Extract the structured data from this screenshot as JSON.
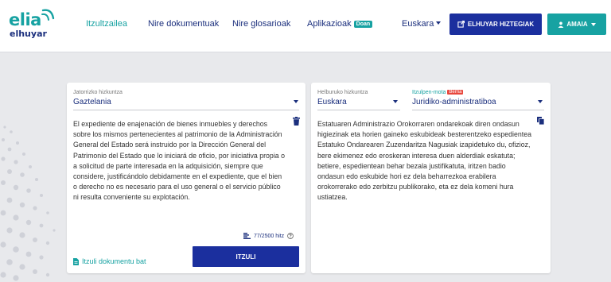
{
  "header": {
    "logo": {
      "brand": "elia",
      "sub": "elhuyar"
    },
    "nav": [
      {
        "label": "Itzultzailea",
        "active": true
      },
      {
        "label": "Nire dokumentuak"
      },
      {
        "label": "Nire glosarioak"
      },
      {
        "label": "Aplikazioak",
        "badge": "Doan"
      }
    ],
    "language": "Euskara",
    "dictionaries_button": "ELHUYAR HIZTEGIAK",
    "user_button": "AMAIA"
  },
  "source": {
    "language_label": "Jatorrizko hizkuntza",
    "language_value": "Gaztelania",
    "text": "El expediente de enajenación de bienes inmuebles y derechos sobre los mismos pertenecientes al patrimonio de la Administración General del Estado será instruido por la Dirección General del Patrimonio del Estado que lo iniciará de oficio, por iniciativa propia o a solicitud de parte interesada en la adquisición, siempre que considere, justificándolo debidamente en el expediente, que el bien o derecho no es necesario para el uso general o el servicio público ni resulta conveniente su explotación.",
    "counter": "77/2500 hitz",
    "upload_label": "Itzuli dokumentu bat",
    "translate_button": "ITZULI"
  },
  "target": {
    "language_label": "Helburuko hizkuntza",
    "language_value": "Euskara",
    "domain_label": "Itzulpen-mota",
    "domain_badge": "Berria",
    "domain_value": "Juridiko-administratiboa",
    "text": "Estatuaren Administrazio Orokorraren ondarekoak diren ondasun higiezinak eta horien gaineko eskubideak besterentzeko espedientea Estatuko Ondarearen Zuzendaritza Nagusiak izapidetuko du, ofizioz, bere ekimenez edo eroskeran interesa duen alderdiak eskatuta; betiere, espedientean behar bezala justifikatuta, iritzen badio ondasun edo eskubide hori ez dela beharrezkoa erabilera orokorrerako edo zerbitzu publikorako, eta ez dela komeni hura ustiatzea."
  },
  "colors": {
    "navy": "#1b2f7d",
    "button_blue": "#1b2f9e",
    "teal": "#17a2a2",
    "badge_red": "#e8463c",
    "background": "#e8e9ec"
  },
  "icons": [
    "trash-icon",
    "copy-icon",
    "external-link-icon",
    "user-icon",
    "text-lines-icon",
    "help-icon",
    "document-icon",
    "caret-down-icon"
  ]
}
